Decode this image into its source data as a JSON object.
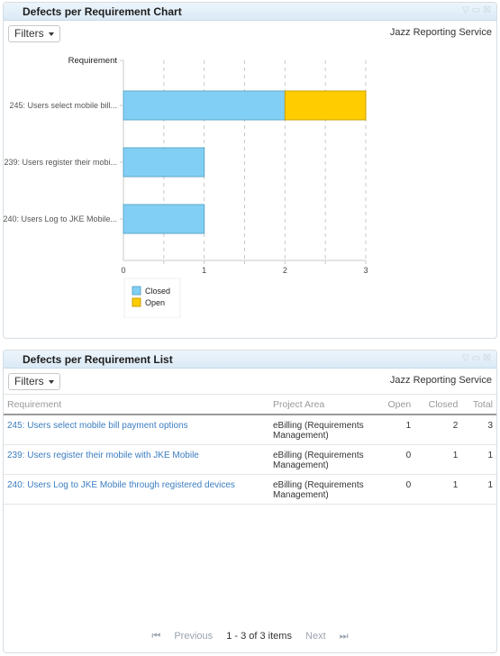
{
  "chart_widget": {
    "title": "Defects per Requirement Chart",
    "filters_label": "Filters",
    "service_label": "Jazz Reporting Service",
    "window_icons": [
      "collapse-icon",
      "maximize-icon",
      "close-icon"
    ]
  },
  "chart_data": {
    "type": "bar",
    "orientation": "horizontal",
    "stacked": true,
    "title": "",
    "ylabel": "Requirement",
    "xlabel": "",
    "categories": [
      "245: Users select mobile bill...",
      "239: Users register their mobi...",
      "240: Users Log to JKE Mobile..."
    ],
    "series": [
      {
        "name": "Closed",
        "color": "#81cff4",
        "values": [
          2,
          1,
          1
        ]
      },
      {
        "name": "Open",
        "color": "#ffcc00",
        "values": [
          1,
          0,
          0
        ]
      }
    ],
    "xlim": [
      0,
      3
    ],
    "xticks": [
      "0",
      "1",
      "2",
      "3"
    ],
    "grid": true,
    "legend": "bottom-left"
  },
  "list_widget": {
    "title": "Defects per Requirement List",
    "filters_label": "Filters",
    "service_label": "Jazz Reporting Service",
    "columns": [
      "Requirement",
      "Project Area",
      "Open",
      "Closed",
      "Total"
    ],
    "rows": [
      {
        "requirement": "245: Users select mobile bill payment options",
        "project_area": "eBilling (Requirements Management)",
        "open": "1",
        "closed": "2",
        "total": "3"
      },
      {
        "requirement": "239: Users register their mobile with JKE Mobile",
        "project_area": "eBilling (Requirements Management)",
        "open": "0",
        "closed": "1",
        "total": "1"
      },
      {
        "requirement": "240: Users Log to JKE Mobile through registered devices",
        "project_area": "eBilling (Requirements Management)",
        "open": "0",
        "closed": "1",
        "total": "1"
      }
    ],
    "pager": {
      "first_icon": "first-page-icon",
      "previous_label": "Previous",
      "count_label": "1 - 3 of 3 items",
      "next_label": "Next",
      "last_icon": "last-page-icon"
    }
  }
}
